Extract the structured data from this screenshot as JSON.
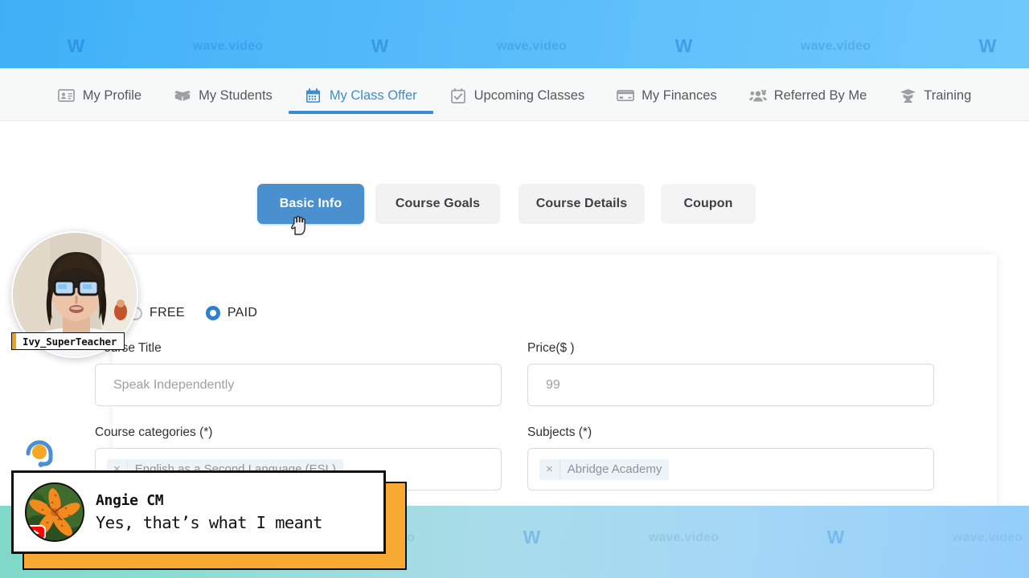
{
  "watermark": {
    "brand_text": "wave.video",
    "logo_glyph": "W",
    "top_band_color": "#52b9f9",
    "bottom_band_color": "#9adcd8"
  },
  "nav": {
    "items": [
      {
        "label": "My Profile",
        "icon": "id-card-icon",
        "active": false
      },
      {
        "label": "My Students",
        "icon": "open-box-icon",
        "active": false
      },
      {
        "label": "My Class Offer",
        "icon": "calendar-icon",
        "active": true
      },
      {
        "label": "Upcoming Classes",
        "icon": "checklist-icon",
        "active": false
      },
      {
        "label": "My Finances",
        "icon": "credit-card-icon",
        "active": false
      },
      {
        "label": "Referred By Me",
        "icon": "people-icon",
        "active": false
      },
      {
        "label": "Training",
        "icon": "graduate-icon",
        "active": false
      }
    ],
    "active_color": "#3b8ed0",
    "inactive_color": "#55595c"
  },
  "tabs": {
    "items": [
      {
        "label": "Basic Info",
        "active": true
      },
      {
        "label": "Course Goals",
        "active": false
      },
      {
        "label": "Course Details",
        "active": false
      },
      {
        "label": "Coupon",
        "active": false
      }
    ],
    "active_bg": "#4a90cf",
    "inactive_bg": "#f2f2f2"
  },
  "form": {
    "pricing": {
      "options": [
        {
          "label": "FREE",
          "selected": false
        },
        {
          "label": "PAID",
          "selected": true
        }
      ],
      "selected_color": "#2d7fd3"
    },
    "course_title": {
      "label": "Course Title",
      "value": "Speak Independently"
    },
    "price": {
      "label": "Price($ )",
      "value": "99"
    },
    "course_categories": {
      "label": "Course categories (*)",
      "tags": [
        "English as a Second Language (ESL)"
      ],
      "remove_glyph": "×"
    },
    "subjects": {
      "label": "Subjects (*)",
      "tags": [
        "Abridge Academy"
      ],
      "remove_glyph": "×"
    }
  },
  "webcam": {
    "name_label": "Ivy_SuperTeacher",
    "accent_color": "#f0a020"
  },
  "comment_overlay": {
    "author": "Angie CM",
    "message": "Yes, that’s what I meant",
    "platform_icon": "youtube-icon",
    "accent_color": "#f7a931"
  },
  "support_widget": {
    "icon": "headset-support-icon",
    "ring_color": "#3b8ed0",
    "center_color": "#f5a623"
  },
  "cursor": {
    "icon": "pointing-hand-cursor"
  }
}
